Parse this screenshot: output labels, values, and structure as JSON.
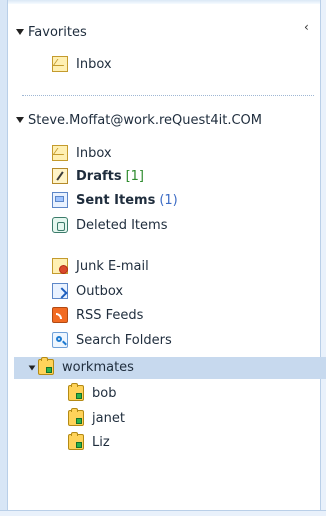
{
  "favorites": {
    "title": "Favorites",
    "items": [
      {
        "label": "Inbox",
        "icon": "inbox-icon"
      }
    ]
  },
  "account": {
    "title": "Steve.Moffat@work.reQuest4it.COM",
    "items": [
      {
        "label": "Inbox",
        "icon": "inbox-icon"
      },
      {
        "label": "Drafts",
        "count": "[1]",
        "icon": "drafts-icon"
      },
      {
        "label": "Sent Items",
        "count": "(1)",
        "icon": "sent-items-icon"
      },
      {
        "label": "Deleted Items",
        "icon": "deleted-items-icon"
      },
      {
        "label": "Junk E-mail",
        "icon": "junk-email-icon"
      },
      {
        "label": "Outbox",
        "icon": "outbox-icon"
      },
      {
        "label": "RSS Feeds",
        "icon": "rss-feeds-icon"
      },
      {
        "label": "Search Folders",
        "icon": "search-folders-icon"
      }
    ],
    "workmates": {
      "label": "workmates",
      "children": [
        "bob",
        "janet",
        "Liz"
      ]
    }
  }
}
